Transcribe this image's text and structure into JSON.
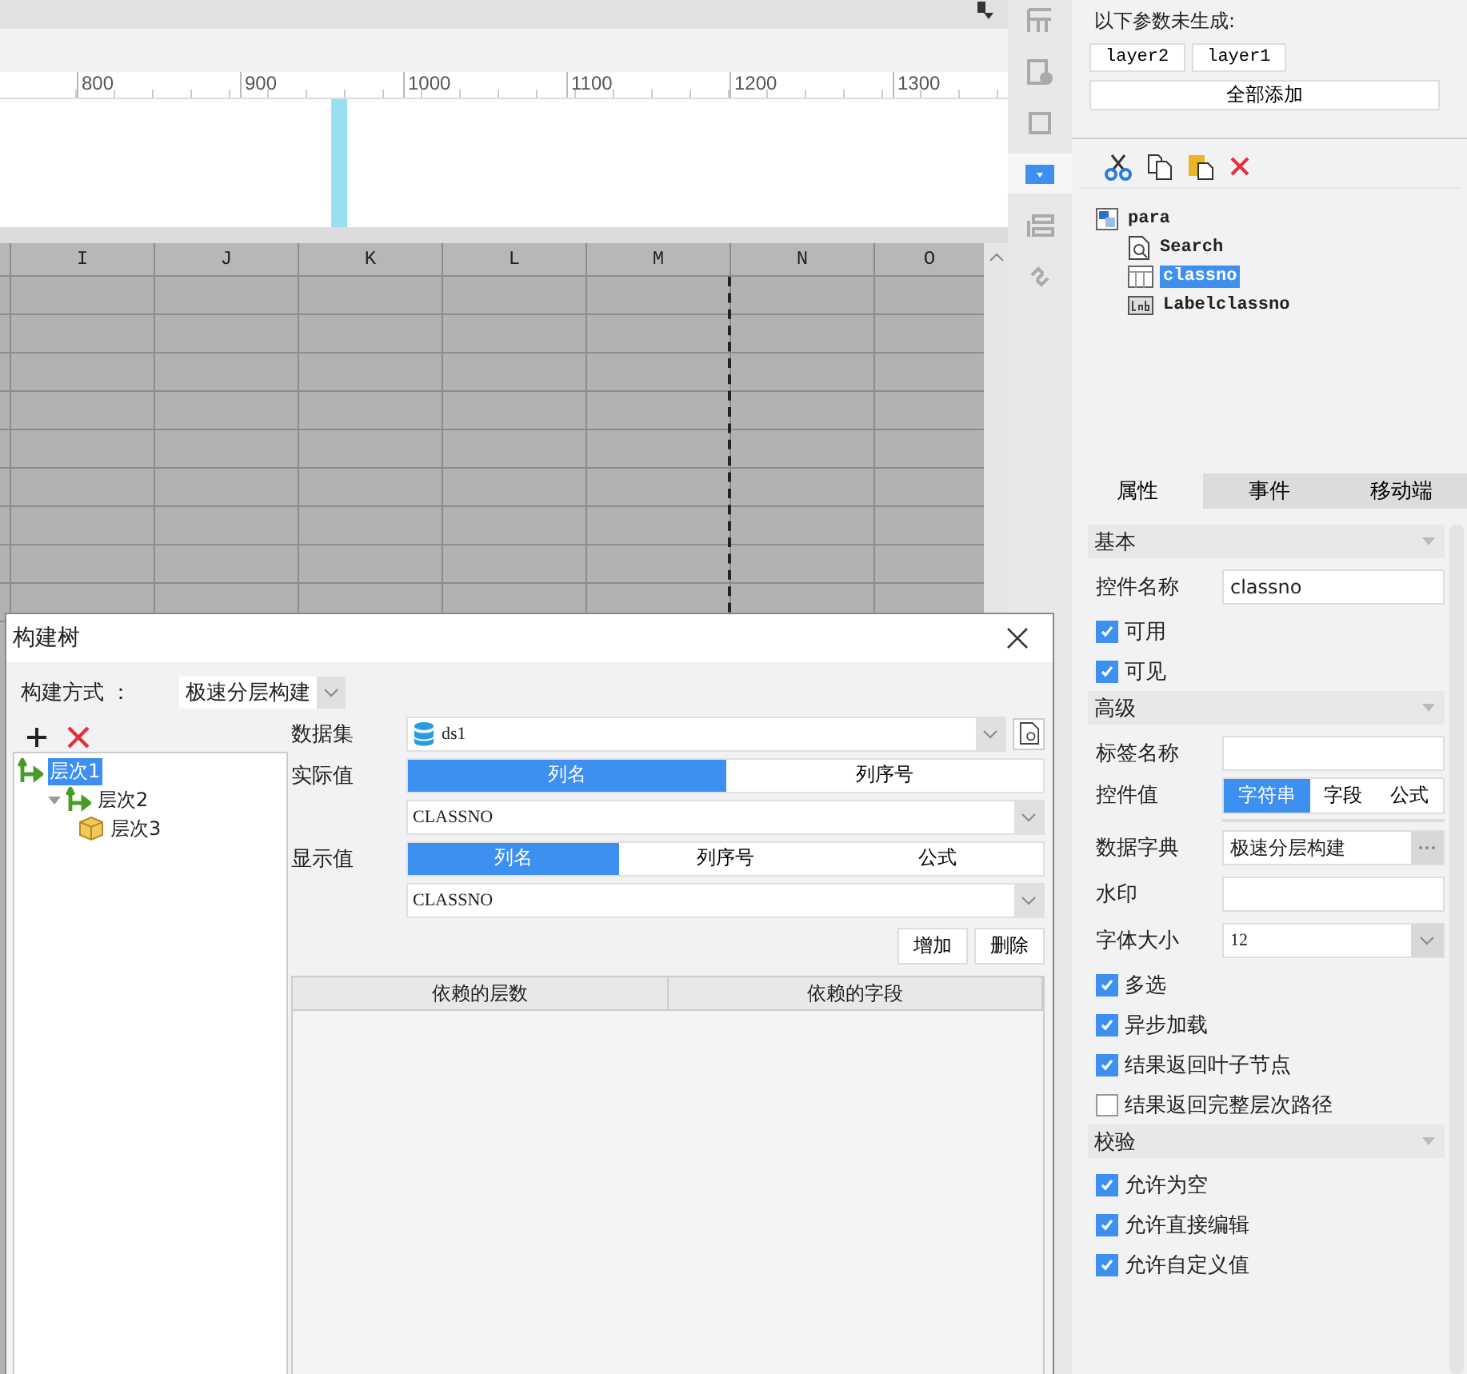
{
  "ruler": {
    "labels": [
      "800",
      "900",
      "1000",
      "1100",
      "1200",
      "1300"
    ]
  },
  "sheet": {
    "columns": [
      "I",
      "J",
      "K",
      "L",
      "M",
      "N",
      "O"
    ]
  },
  "side_toolbar": [
    {
      "kind": "grid",
      "selected": false
    },
    {
      "kind": "info",
      "selected": false
    },
    {
      "kind": "frame",
      "selected": false
    },
    {
      "kind": "dropdown",
      "selected": true
    },
    {
      "kind": "layout",
      "selected": false
    },
    {
      "kind": "link",
      "selected": false
    }
  ],
  "params": {
    "heading": "以下参数未生成:",
    "chips": [
      "layer2",
      "layer1"
    ],
    "add_all": "全部添加"
  },
  "widget_tree": {
    "label": "para",
    "children": [
      {
        "label": "Search",
        "kind": "search",
        "selected": false
      },
      {
        "label": "classno",
        "kind": "tree",
        "selected": true
      },
      {
        "label": "Labelclassno",
        "kind": "label",
        "selected": false
      }
    ]
  },
  "panel_tabs": [
    {
      "label": "属性",
      "selected": true
    },
    {
      "label": "事件",
      "selected": false
    },
    {
      "label": "移动端",
      "selected": false
    }
  ],
  "properties": [
    {
      "kind": "section",
      "label": "基本"
    },
    {
      "kind": "text",
      "label": "控件名称",
      "value": "classno"
    },
    {
      "kind": "checkbox",
      "label": "可用",
      "checked": true
    },
    {
      "kind": "checkbox",
      "label": "可见",
      "checked": true
    },
    {
      "kind": "section",
      "label": "高级"
    },
    {
      "kind": "text",
      "label": "标签名称"
    },
    {
      "kind": "segmented",
      "label": "控件值",
      "options": [
        {
          "label": "字符串",
          "selected": true
        },
        {
          "label": "字段",
          "selected": false
        },
        {
          "label": "公式",
          "selected": false
        }
      ]
    },
    {
      "kind": "dict",
      "label": "数据字典",
      "value": "极速分层构建"
    },
    {
      "kind": "text",
      "label": "水印"
    },
    {
      "kind": "select",
      "label": "字体大小",
      "value": "12"
    },
    {
      "kind": "checkbox",
      "label": "多选",
      "checked": true
    },
    {
      "kind": "checkbox",
      "label": "异步加载",
      "checked": true
    },
    {
      "kind": "checkbox",
      "label": "结果返回叶子节点",
      "checked": true
    },
    {
      "kind": "checkbox",
      "label": "结果返回完整层次路径",
      "checked": false
    },
    {
      "kind": "section",
      "label": "校验"
    },
    {
      "kind": "checkbox",
      "label": "允许为空",
      "checked": true
    },
    {
      "kind": "checkbox",
      "label": "允许直接编辑",
      "checked": true
    },
    {
      "kind": "checkbox",
      "label": "允许自定义值",
      "checked": true
    }
  ],
  "dialog": {
    "title": "构建树",
    "build_mode": {
      "label": "构建方式 ：",
      "value": "极速分层构建"
    },
    "levels": [
      {
        "label": "层次1",
        "selected": true,
        "children": [
          {
            "label": "层次2",
            "selected": false,
            "expanded": true,
            "children": [
              {
                "label": "层次3",
                "selected": false
              }
            ]
          }
        ]
      }
    ],
    "dataset": {
      "label": "数据集",
      "value": "ds1"
    },
    "actual_value": {
      "label": "实际值",
      "options": [
        {
          "label": "列名",
          "selected": true
        },
        {
          "label": "列序号",
          "selected": false
        }
      ],
      "value": "CLASSNO"
    },
    "display_value": {
      "label": "显示值",
      "options": [
        {
          "label": "列名",
          "selected": true
        },
        {
          "label": "列序号",
          "selected": false
        },
        {
          "label": "公式",
          "selected": false
        }
      ],
      "value": "CLASSNO"
    },
    "buttons": [
      "增加",
      "删除"
    ],
    "table": {
      "columns": [
        "依赖的层数",
        "依赖的字段"
      ]
    }
  }
}
